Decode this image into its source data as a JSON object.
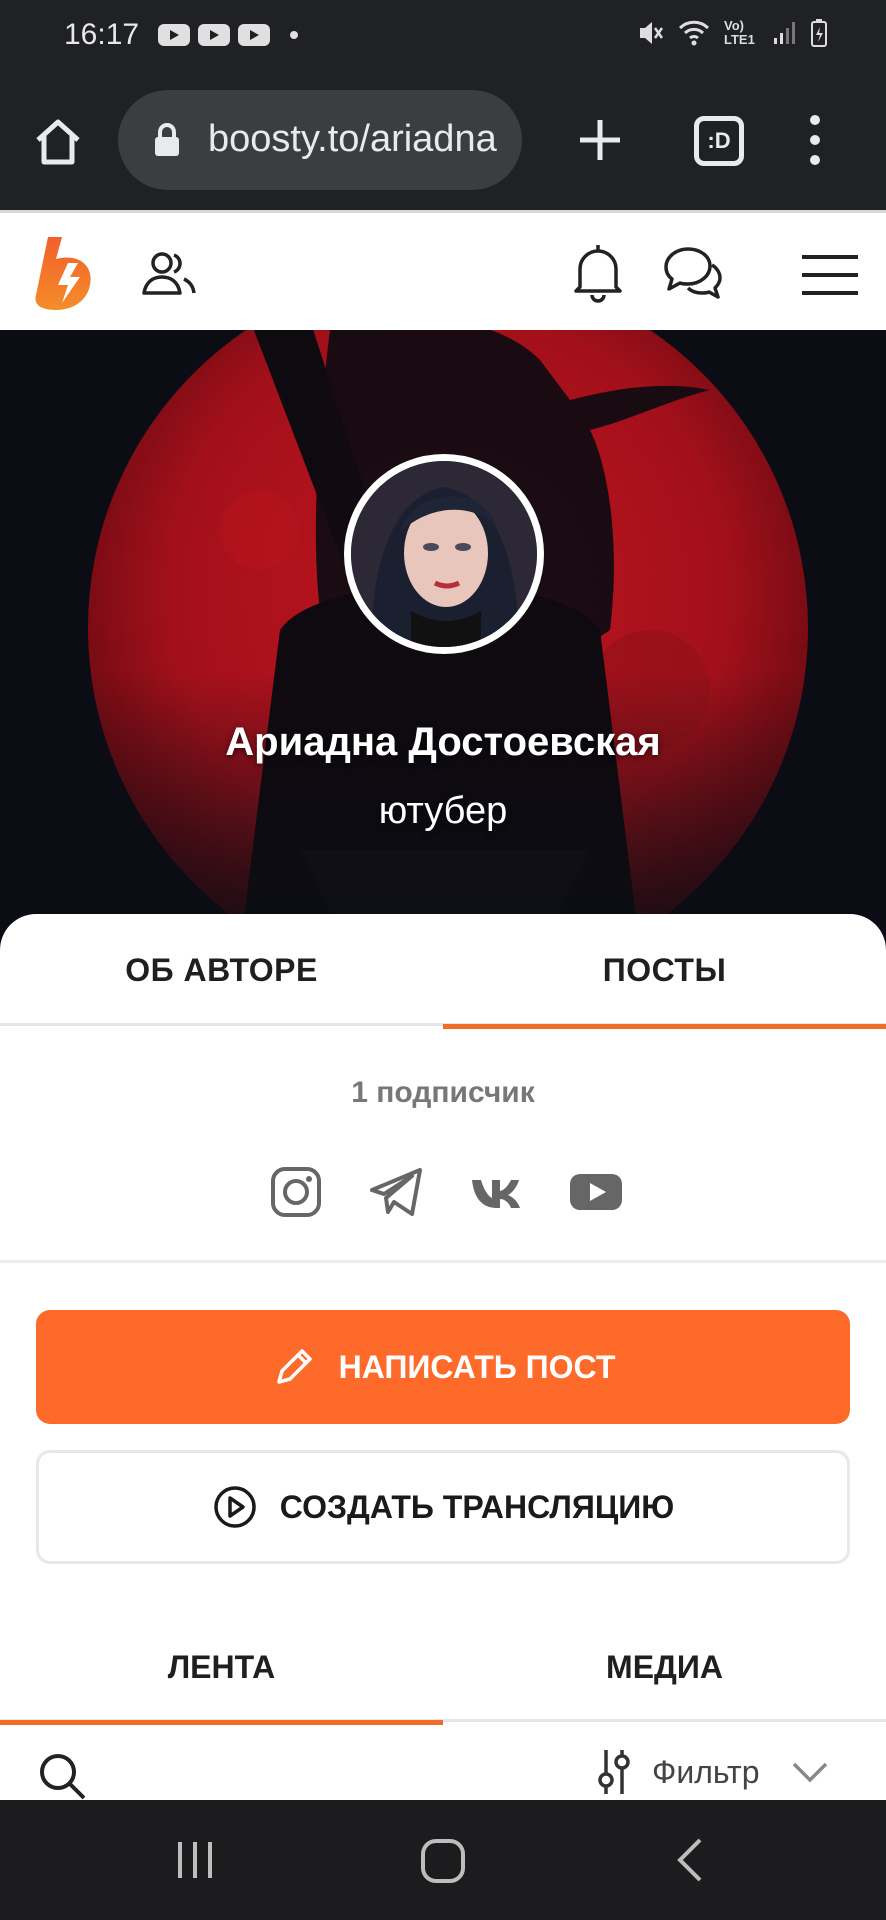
{
  "status_bar": {
    "time": "16:17",
    "network_label": "Vo) LTE1"
  },
  "browser": {
    "url": "boosty.to/ariadna",
    "tabs_label": ":D"
  },
  "profile": {
    "name": "Ариадна Достоевская",
    "role": "ютубер",
    "subscribers": "1 подписчик"
  },
  "tabs": {
    "about": "ОБ АВТОРЕ",
    "posts": "ПОСТЫ",
    "active": "posts"
  },
  "socials": [
    "instagram-icon",
    "telegram-icon",
    "vk-icon",
    "youtube-icon"
  ],
  "actions": {
    "write_post": "НАПИСАТЬ ПОСТ",
    "create_stream": "СОЗДАТЬ ТРАНСЛЯЦИЮ"
  },
  "feed_tabs": {
    "feed": "ЛЕНТА",
    "media": "МЕДИА",
    "active": "feed"
  },
  "filter": {
    "label": "Фильтр"
  },
  "colors": {
    "accent": "#fd6a2a",
    "browser_bg": "#202124",
    "hero_moon": "#b3121c"
  }
}
